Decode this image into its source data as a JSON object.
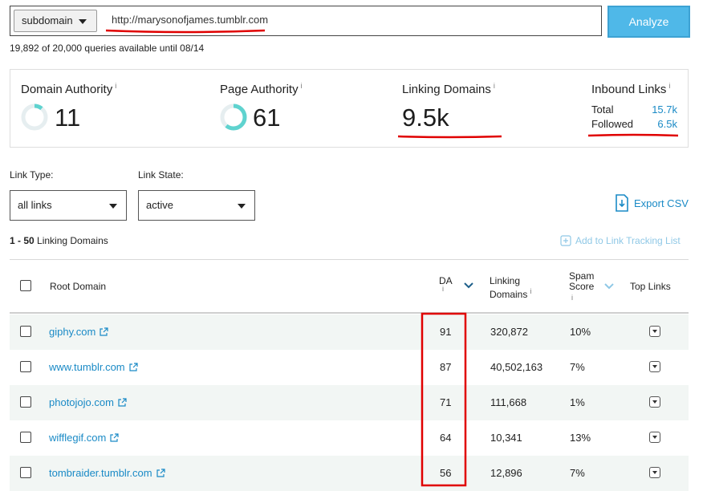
{
  "search": {
    "scope": "subdomain",
    "url": "http://marysonofjames.tumblr.com",
    "analyze_label": "Analyze",
    "quota": "19,892 of 20,000 queries available until 08/14"
  },
  "metrics": {
    "domain_authority": {
      "title": "Domain Authority",
      "info": "i",
      "value": "11",
      "fraction": 0.11
    },
    "page_authority": {
      "title": "Page Authority",
      "info": "i",
      "value": "61",
      "fraction": 0.61
    },
    "linking_domains": {
      "title": "Linking Domains",
      "info": "i",
      "value": "9.5k"
    },
    "inbound_links": {
      "title": "Inbound Links",
      "info": "i",
      "total_label": "Total",
      "total_value": "15.7k",
      "followed_label": "Followed",
      "followed_value": "6.5k"
    }
  },
  "filters": {
    "link_type_label": "Link Type:",
    "link_type_value": "all links",
    "link_state_label": "Link State:",
    "link_state_value": "active",
    "export_label": "Export CSV",
    "range_bold": "1 - 50",
    "range_rest": "Linking Domains",
    "add_tracking_label": "Add to Link Tracking List"
  },
  "table": {
    "headers": {
      "root_domain": "Root Domain",
      "da": "DA",
      "da_info": "i",
      "linking_domains_1": "Linking",
      "linking_domains_2": "Domains",
      "linking_info": "i",
      "spam_1": "Spam",
      "spam_2": "Score",
      "spam_info": "i",
      "top_links": "Top Links"
    },
    "rows": [
      {
        "domain": "giphy.com",
        "da": "91",
        "linking_domains": "320,872",
        "spam": "10%"
      },
      {
        "domain": "www.tumblr.com",
        "da": "87",
        "linking_domains": "40,502,163",
        "spam": "7%"
      },
      {
        "domain": "photojojo.com",
        "da": "71",
        "linking_domains": "111,668",
        "spam": "1%"
      },
      {
        "domain": "wifflegif.com",
        "da": "64",
        "linking_domains": "10,341",
        "spam": "13%"
      },
      {
        "domain": "tombraider.tumblr.com",
        "da": "56",
        "linking_domains": "12,896",
        "spam": "7%"
      }
    ]
  },
  "colors": {
    "accent": "#4fb8e8",
    "link": "#1a8ac6",
    "ring": "#5fd3cf",
    "annotation": "#e00000"
  }
}
